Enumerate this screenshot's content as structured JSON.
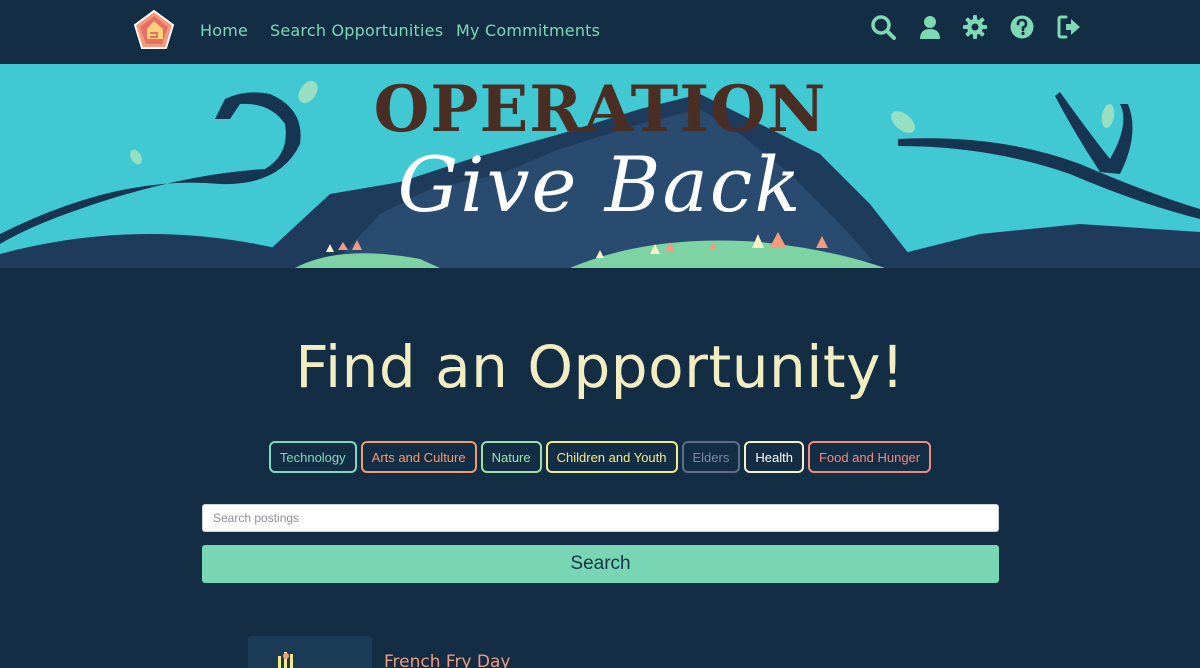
{
  "nav": {
    "logo_name": "house-pentagon-logo",
    "links": [
      "Home",
      "Search Opportunities",
      "My Commitments"
    ],
    "icons": [
      "search-icon",
      "user-icon",
      "gear-icon",
      "help-icon",
      "sign-out-icon"
    ],
    "accent": "#7dd9b4"
  },
  "banner": {
    "title": "OPERATION",
    "subtitle": "Give Back"
  },
  "main": {
    "heading": "Find an Opportunity!",
    "categories": [
      {
        "label": "Technology",
        "color": "#7dd9c0",
        "text": "#7dd9c0"
      },
      {
        "label": "Arts and Culture",
        "color": "#f29b6f",
        "text": "#f29b6f"
      },
      {
        "label": "Nature",
        "color": "#9fe0a8",
        "text": "#9fe0a8"
      },
      {
        "label": "Children and Youth",
        "color": "#f3ea8b",
        "text": "#f3ea8b"
      },
      {
        "label": "Elders",
        "color": "#5f6e86",
        "text": "#7d8aa2"
      },
      {
        "label": "Health",
        "color": "#f6f1c7",
        "text": "#ffffff"
      },
      {
        "label": "Food and Hunger",
        "color": "#f28a80",
        "text": "#f28a80"
      }
    ],
    "search": {
      "placeholder": "Search postings",
      "value": "",
      "button_label": "Search"
    },
    "results": [
      {
        "title": "French Fry Day"
      }
    ]
  }
}
